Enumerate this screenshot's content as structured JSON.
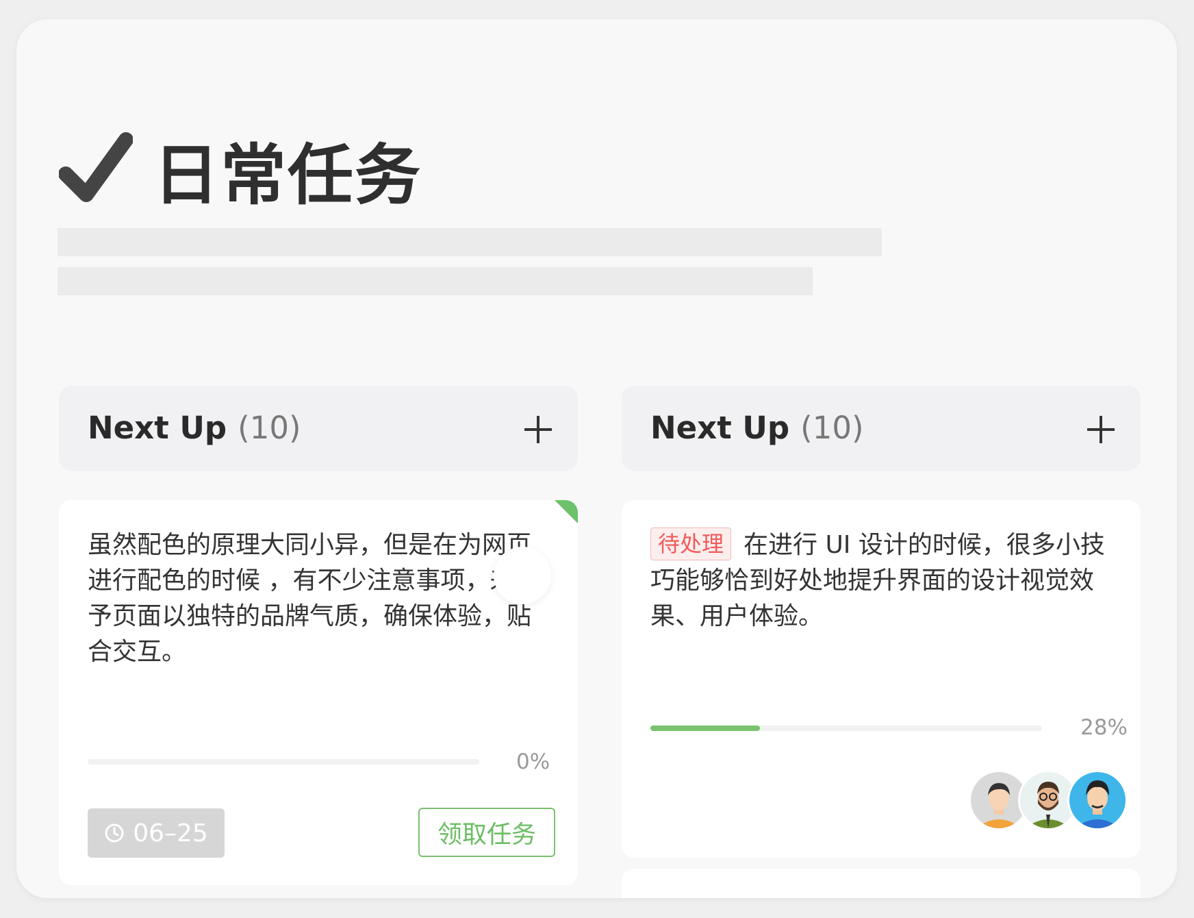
{
  "header": {
    "title": "日常任务"
  },
  "columns": [
    {
      "title": "Next Up",
      "count": "(10)"
    },
    {
      "title": "Next Up",
      "count": "(10)"
    }
  ],
  "cards": [
    {
      "text": "虽然配色的原理大同小异，但是在为网页进行配色的时候 ，有不少注意事项，来赋予页面以独特的品牌气质，确保体验，贴合交互。",
      "progress": 0,
      "progress_label": "0%",
      "date": "06–25",
      "claim_label": "领取任务",
      "accent_color": "#6cc26a"
    },
    {
      "badge": "待处理",
      "text": "在进行 UI 设计的时候，很多小技巧能够恰到好处地提升界面的设计视觉效果、用户体验。",
      "progress": 0.28,
      "progress_label": "28%",
      "avatars": [
        "avatar-1",
        "avatar-2",
        "avatar-3"
      ]
    }
  ],
  "icons": [
    "check-icon",
    "plus-icon",
    "clock-icon"
  ],
  "colors": {
    "accent": "#6cc26a",
    "badge_red": "#f05b5b",
    "title": "#2f2f2f"
  }
}
